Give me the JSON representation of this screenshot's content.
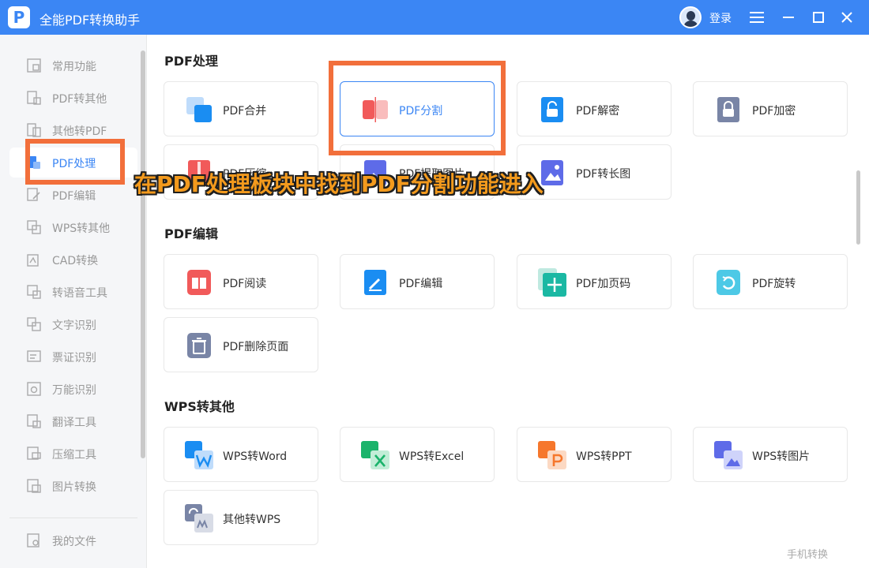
{
  "app": {
    "logo": "P",
    "title": "全能PDF转换助手",
    "login": "登录"
  },
  "sidebar": {
    "items": [
      {
        "label": "常用功能",
        "icon": "grid-icon"
      },
      {
        "label": "PDF转其他",
        "icon": "pdf-export-icon"
      },
      {
        "label": "其他转PDF",
        "icon": "pdf-import-icon"
      },
      {
        "label": "PDF处理",
        "icon": "pdf-process-icon"
      },
      {
        "label": "PDF编辑",
        "icon": "pdf-edit-icon"
      },
      {
        "label": "WPS转其他",
        "icon": "wps-icon"
      },
      {
        "label": "CAD转换",
        "icon": "cad-icon"
      },
      {
        "label": "转语音工具",
        "icon": "voice-icon"
      },
      {
        "label": "文字识别",
        "icon": "ocr-icon"
      },
      {
        "label": "票证识别",
        "icon": "ticket-icon"
      },
      {
        "label": "万能识别",
        "icon": "eye-icon"
      },
      {
        "label": "翻译工具",
        "icon": "translate-icon"
      },
      {
        "label": "压缩工具",
        "icon": "zip-icon"
      },
      {
        "label": "图片转换",
        "icon": "image-icon"
      }
    ],
    "my_files": "我的文件"
  },
  "sections": [
    {
      "title": "PDF处理",
      "cards": [
        "PDF合并",
        "PDF分割",
        "PDF解密",
        "PDF加密",
        "PDF压缩",
        "PDF提取图片",
        "PDF转长图"
      ]
    },
    {
      "title": "PDF编辑",
      "cards": [
        "PDF阅读",
        "PDF编辑",
        "PDF加页码",
        "PDF旋转",
        "PDF删除页面"
      ]
    },
    {
      "title": "WPS转其他",
      "cards": [
        "WPS转Word",
        "WPS转Excel",
        "WPS转PPT",
        "WPS转图片",
        "其他转WPS"
      ]
    }
  ],
  "footer": {
    "mobile": "手机转换"
  },
  "annotation": {
    "text": "在PDF处理板块中找到PDF分割功能进入"
  },
  "colors": {
    "accent": "#3b86f4",
    "highlight": "#f26f3b",
    "annotation_text": "#f39a1d"
  }
}
